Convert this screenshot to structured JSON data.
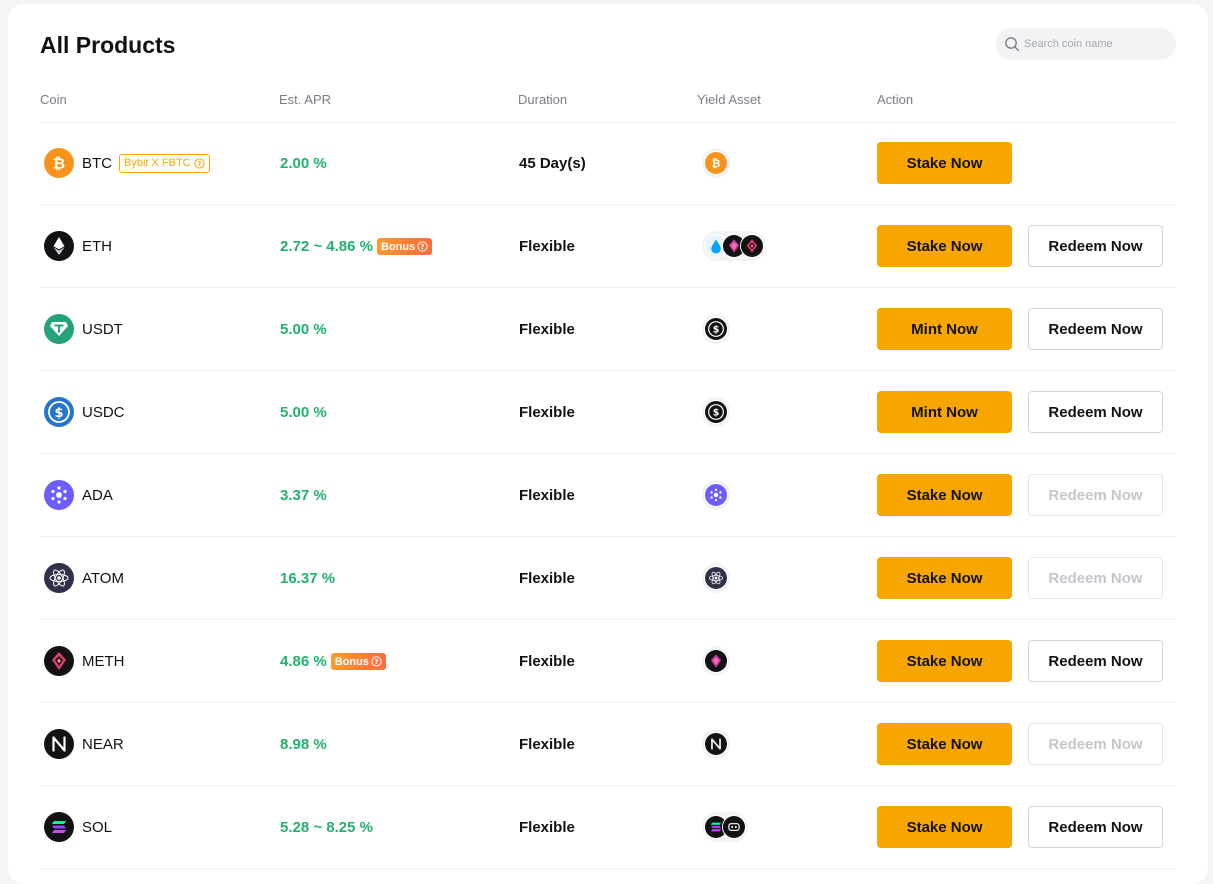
{
  "page": {
    "title": "All Products",
    "search_placeholder": "Search coin name"
  },
  "columns": [
    "Coin",
    "Est. APR",
    "Duration",
    "Yield Asset",
    "Action"
  ],
  "colors": {
    "accent": "#f7a600",
    "apr_green": "#20b26c",
    "bonus_orange": "#ff7a30"
  },
  "rows": [
    {
      "coin": "BTC",
      "coin_icon": "btc-icon",
      "tag": "Bybit X FBTC",
      "apr": "2.00 %",
      "bonus": "",
      "duration": "45 Day(s)",
      "yield_icons": [
        "btc-icon"
      ],
      "primary": "Stake Now",
      "secondary": "",
      "secondary_disabled": false
    },
    {
      "coin": "ETH",
      "coin_icon": "eth-icon",
      "tag": "",
      "apr": "2.72 ~ 4.86 %",
      "bonus": "Bonus",
      "duration": "Flexible",
      "yield_icons": [
        "steth-icon",
        "cmeth-icon",
        "meth-icon"
      ],
      "primary": "Stake Now",
      "secondary": "Redeem Now",
      "secondary_disabled": false
    },
    {
      "coin": "USDT",
      "coin_icon": "usdt-icon",
      "tag": "",
      "apr": "5.00 %",
      "bonus": "",
      "duration": "Flexible",
      "yield_icons": [
        "usde-icon"
      ],
      "primary": "Mint Now",
      "secondary": "Redeem Now",
      "secondary_disabled": false
    },
    {
      "coin": "USDC",
      "coin_icon": "usdc-icon",
      "tag": "",
      "apr": "5.00 %",
      "bonus": "",
      "duration": "Flexible",
      "yield_icons": [
        "usde-icon"
      ],
      "primary": "Mint Now",
      "secondary": "Redeem Now",
      "secondary_disabled": false
    },
    {
      "coin": "ADA",
      "coin_icon": "ada-icon",
      "tag": "",
      "apr": "3.37 %",
      "bonus": "",
      "duration": "Flexible",
      "yield_icons": [
        "ada-icon"
      ],
      "primary": "Stake Now",
      "secondary": "Redeem Now",
      "secondary_disabled": true
    },
    {
      "coin": "ATOM",
      "coin_icon": "atom-icon",
      "tag": "",
      "apr": "16.37 %",
      "bonus": "",
      "duration": "Flexible",
      "yield_icons": [
        "atom-icon"
      ],
      "primary": "Stake Now",
      "secondary": "Redeem Now",
      "secondary_disabled": true
    },
    {
      "coin": "METH",
      "coin_icon": "meth-icon",
      "tag": "",
      "apr": "4.86 %",
      "bonus": "Bonus",
      "duration": "Flexible",
      "yield_icons": [
        "cmeth-icon"
      ],
      "primary": "Stake Now",
      "secondary": "Redeem Now",
      "secondary_disabled": false
    },
    {
      "coin": "NEAR",
      "coin_icon": "near-icon",
      "tag": "",
      "apr": "8.98 %",
      "bonus": "",
      "duration": "Flexible",
      "yield_icons": [
        "near-icon"
      ],
      "primary": "Stake Now",
      "secondary": "Redeem Now",
      "secondary_disabled": true
    },
    {
      "coin": "SOL",
      "coin_icon": "sol-icon",
      "tag": "",
      "apr": "5.28 ~ 8.25 %",
      "bonus": "",
      "duration": "Flexible",
      "yield_icons": [
        "sol-icon",
        "bbsol-icon"
      ],
      "primary": "Stake Now",
      "secondary": "Redeem Now",
      "secondary_disabled": false
    }
  ]
}
